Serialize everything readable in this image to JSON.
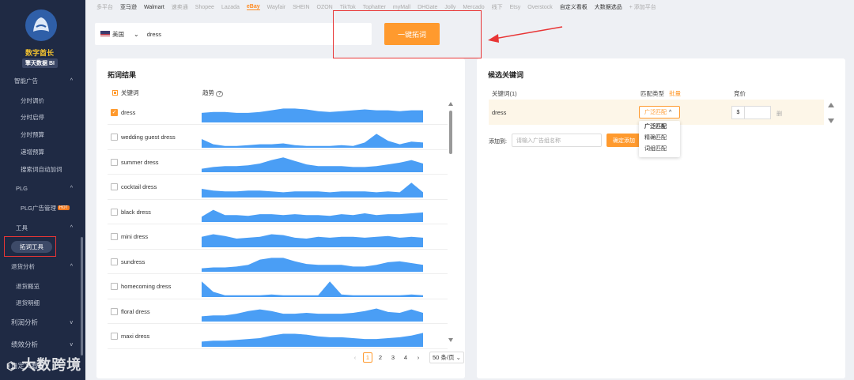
{
  "sidebar": {
    "brand": "数字酋长",
    "brand_sub": "擎天数据 BI",
    "items": [
      {
        "label": "智能广告",
        "chev": "^"
      },
      {
        "label": "分时调价"
      },
      {
        "label": "分时启停"
      },
      {
        "label": "分时预算"
      },
      {
        "label": "递增预算"
      },
      {
        "label": "搜索词自动加词"
      },
      {
        "label": "PLG",
        "chev": "^"
      },
      {
        "label": "PLG广告管理",
        "badge": "HOT"
      },
      {
        "label": "工具",
        "chev": "^"
      },
      {
        "label": "拓词工具"
      },
      {
        "label": "退货分析",
        "chev": "^"
      },
      {
        "label": "退货概览"
      },
      {
        "label": "退货明细"
      },
      {
        "label": "利润分析",
        "chev": "v"
      },
      {
        "label": "绩效分析",
        "chev": "v"
      },
      {
        "label": "自定义看板"
      }
    ]
  },
  "platforms": [
    {
      "label": "多平台",
      "style": "muted"
    },
    {
      "label": "亚马逊",
      "style": "dark"
    },
    {
      "label": "Walmart",
      "style": "dark"
    },
    {
      "label": "速卖通",
      "style": "muted"
    },
    {
      "label": "Shopee",
      "style": "muted"
    },
    {
      "label": "Lazada",
      "style": "muted"
    },
    {
      "label": "eBay",
      "style": "active"
    },
    {
      "label": "Wayfair",
      "style": "muted"
    },
    {
      "label": "SHEIN",
      "style": "muted"
    },
    {
      "label": "OZON",
      "style": "muted"
    },
    {
      "label": "TikTok",
      "style": "muted"
    },
    {
      "label": "Tophatter",
      "style": "muted"
    },
    {
      "label": "myMall",
      "style": "muted"
    },
    {
      "label": "DHGate",
      "style": "muted"
    },
    {
      "label": "Jolly",
      "style": "muted"
    },
    {
      "label": "Mercado",
      "style": "muted"
    },
    {
      "label": "线下",
      "style": "muted"
    },
    {
      "label": "Etsy",
      "style": "muted"
    },
    {
      "label": "Overstock",
      "style": "muted"
    },
    {
      "label": "自定义看板",
      "style": "dark"
    },
    {
      "label": "大数据选品",
      "style": "dark"
    },
    {
      "label": "+ 添加平台",
      "style": "muted"
    }
  ],
  "search": {
    "country": "美国",
    "keyword": "dress",
    "button": "一键拓词"
  },
  "results": {
    "title": "拓词结果",
    "col_keyword": "关键词",
    "col_trend": "趋势",
    "rows": [
      {
        "keyword": "dress",
        "checked": true,
        "trend": [
          0.55,
          0.6,
          0.6,
          0.55,
          0.55,
          0.6,
          0.7,
          0.8,
          0.8,
          0.75,
          0.65,
          0.6,
          0.65,
          0.7,
          0.75,
          0.7,
          0.7,
          0.65,
          0.7,
          0.7
        ]
      },
      {
        "keyword": "wedding guest dress",
        "checked": false,
        "trend": [
          0.5,
          0.2,
          0.1,
          0.1,
          0.15,
          0.2,
          0.2,
          0.25,
          0.15,
          0.1,
          0.1,
          0.1,
          0.15,
          0.1,
          0.3,
          0.8,
          0.4,
          0.2,
          0.35,
          0.3
        ]
      },
      {
        "keyword": "summer dress",
        "checked": false,
        "trend": [
          0.2,
          0.3,
          0.35,
          0.35,
          0.4,
          0.5,
          0.7,
          0.85,
          0.65,
          0.45,
          0.35,
          0.35,
          0.35,
          0.3,
          0.3,
          0.35,
          0.45,
          0.55,
          0.7,
          0.5
        ]
      },
      {
        "keyword": "cocktail dress",
        "checked": false,
        "trend": [
          0.5,
          0.4,
          0.35,
          0.35,
          0.4,
          0.4,
          0.35,
          0.3,
          0.35,
          0.35,
          0.35,
          0.3,
          0.35,
          0.35,
          0.35,
          0.3,
          0.35,
          0.3,
          0.85,
          0.3
        ]
      },
      {
        "keyword": "black dress",
        "checked": false,
        "trend": [
          0.3,
          0.7,
          0.4,
          0.4,
          0.35,
          0.45,
          0.45,
          0.4,
          0.45,
          0.4,
          0.4,
          0.35,
          0.45,
          0.4,
          0.5,
          0.4,
          0.45,
          0.45,
          0.5,
          0.55
        ]
      },
      {
        "keyword": "mini dress",
        "checked": false,
        "trend": [
          0.6,
          0.75,
          0.65,
          0.5,
          0.55,
          0.6,
          0.75,
          0.7,
          0.55,
          0.5,
          0.6,
          0.55,
          0.6,
          0.6,
          0.55,
          0.6,
          0.65,
          0.55,
          0.6,
          0.55
        ]
      },
      {
        "keyword": "sundress",
        "checked": false,
        "trend": [
          0.2,
          0.25,
          0.25,
          0.3,
          0.4,
          0.7,
          0.8,
          0.8,
          0.6,
          0.45,
          0.4,
          0.4,
          0.4,
          0.3,
          0.3,
          0.4,
          0.55,
          0.6,
          0.5,
          0.4
        ]
      },
      {
        "keyword": "homecoming dress",
        "checked": false,
        "trend": [
          0.9,
          0.3,
          0.1,
          0.1,
          0.1,
          0.1,
          0.15,
          0.1,
          0.1,
          0.1,
          0.1,
          0.9,
          0.15,
          0.1,
          0.1,
          0.1,
          0.1,
          0.1,
          0.15,
          0.1
        ]
      },
      {
        "keyword": "floral dress",
        "checked": false,
        "trend": [
          0.3,
          0.35,
          0.35,
          0.45,
          0.6,
          0.7,
          0.6,
          0.45,
          0.45,
          0.5,
          0.45,
          0.45,
          0.45,
          0.5,
          0.6,
          0.75,
          0.55,
          0.5,
          0.7,
          0.5
        ]
      },
      {
        "keyword": "maxi dress",
        "checked": false,
        "trend": [
          0.3,
          0.35,
          0.35,
          0.4,
          0.45,
          0.5,
          0.65,
          0.75,
          0.75,
          0.7,
          0.6,
          0.55,
          0.55,
          0.5,
          0.45,
          0.45,
          0.5,
          0.55,
          0.65,
          0.8
        ]
      }
    ],
    "pagination": {
      "prev": "‹",
      "pages": [
        "1",
        "2",
        "3",
        "4"
      ],
      "current": "1",
      "next": "›",
      "page_size": "50 条/页"
    }
  },
  "candidates": {
    "title": "候选关键词",
    "col_keyword": "关键词(1)",
    "col_match": "匹配类型",
    "batch": "批量",
    "col_bid": "竞价",
    "row": {
      "keyword": "dress",
      "match": "广泛匹配",
      "currency": "$",
      "delete": "删"
    },
    "match_options": [
      "广泛匹配",
      "精确匹配",
      "词组匹配"
    ],
    "add_label": "添加到:",
    "add_placeholder": "请输入广告组名称",
    "confirm": "确定添加"
  },
  "watermark": "大数跨境",
  "colors": {
    "accent": "#ff9a2e",
    "sidebar": "#1f2a44",
    "trend": "#4a9ef5",
    "annotation": "#e83535"
  }
}
